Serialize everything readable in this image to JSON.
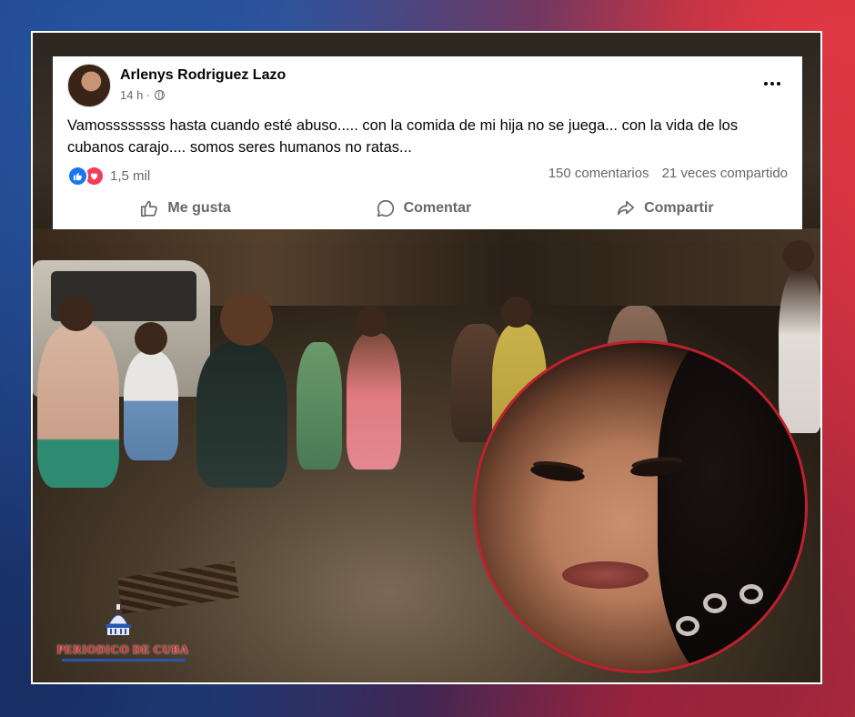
{
  "post": {
    "author": "Arlenys Rodriguez Lazo",
    "time": "14 h ·",
    "privacy_icon": "globe-icon",
    "text": "Vamossssssss hasta cuando esté abuso..... con la comida de mi hija no se juega... con la vida de los cubanos carajo.... somos seres humanos no ratas...",
    "reactions_count": "1,5 mil",
    "comments_count": "150 comentarios",
    "shares_count": "21 veces compartido",
    "actions": {
      "like": "Me gusta",
      "comment": "Comentar",
      "share": "Compartir"
    }
  },
  "watermark": {
    "text": "PERIODICO DE CUBA"
  },
  "colors": {
    "like_blue": "#1877f2",
    "love_red": "#f33e58",
    "portrait_border": "#c0202d",
    "text_secondary": "#65676b"
  }
}
